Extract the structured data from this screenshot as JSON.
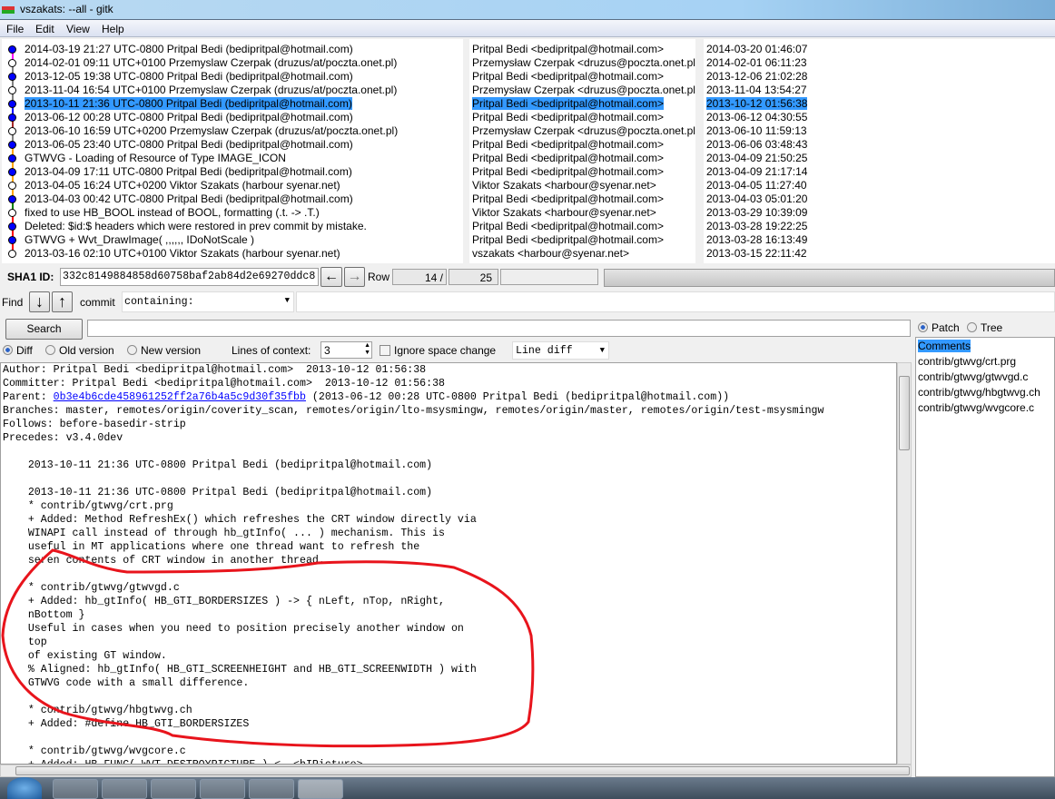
{
  "window": {
    "title": "vszakats: --all - gitk"
  },
  "menu": [
    "File",
    "Edit",
    "View",
    "Help"
  ],
  "commits": [
    {
      "subject": "2014-03-19 21:27 UTC-0800 Pritpal Bedi (bedipritpal@hotmail.com)",
      "author": "Pritpal Bedi <bedipritpal@hotmail.com>",
      "date": "2014-03-20 01:46:07",
      "filled": true
    },
    {
      "subject": "2014-02-01 09:11 UTC+0100 Przemyslaw Czerpak (druzus/at/poczta.onet.pl)",
      "author": "Przemysław Czerpak <druzus@poczta.onet.pl>",
      "date": "2014-02-01 06:11:23",
      "filled": false
    },
    {
      "subject": "2013-12-05 19:38 UTC-0800 Pritpal Bedi (bedipritpal@hotmail.com)",
      "author": "Pritpal Bedi <bedipritpal@hotmail.com>",
      "date": "2013-12-06 21:02:28",
      "filled": true
    },
    {
      "subject": "2013-11-04 16:54 UTC+0100 Przemyslaw Czerpak (druzus/at/poczta.onet.pl)",
      "author": "Przemysław Czerpak <druzus@poczta.onet.pl>",
      "date": "2013-11-04 13:54:27",
      "filled": false
    },
    {
      "subject": "2013-10-11 21:36 UTC-0800 Pritpal Bedi (bedipritpal@hotmail.com)",
      "author": "Pritpal Bedi <bedipritpal@hotmail.com>",
      "date": "2013-10-12 01:56:38",
      "filled": true,
      "selected": true
    },
    {
      "subject": "2013-06-12 00:28 UTC-0800 Pritpal Bedi (bedipritpal@hotmail.com)",
      "author": "Pritpal Bedi <bedipritpal@hotmail.com>",
      "date": "2013-06-12 04:30:55",
      "filled": true
    },
    {
      "subject": "2013-06-10 16:59 UTC+0200 Przemyslaw Czerpak (druzus/at/poczta.onet.pl)",
      "author": "Przemysław Czerpak <druzus@poczta.onet.pl>",
      "date": "2013-06-10 11:59:13",
      "filled": false
    },
    {
      "subject": "2013-06-05 23:40 UTC-0800 Pritpal Bedi (bedipritpal@hotmail.com)",
      "author": "Pritpal Bedi <bedipritpal@hotmail.com>",
      "date": "2013-06-06 03:48:43",
      "filled": true
    },
    {
      "subject": "GTWVG - Loading of Resource of Type IMAGE_ICON",
      "author": "Pritpal Bedi <bedipritpal@hotmail.com>",
      "date": "2013-04-09 21:50:25",
      "filled": true
    },
    {
      "subject": "2013-04-09 17:11 UTC-0800 Pritpal Bedi (bedipritpal@hotmail.com)",
      "author": "Pritpal Bedi <bedipritpal@hotmail.com>",
      "date": "2013-04-09 21:17:14",
      "filled": true
    },
    {
      "subject": "2013-04-05 16:24 UTC+0200 Viktor Szakats (harbour syenar.net)",
      "author": "Viktor Szakats <harbour@syenar.net>",
      "date": "2013-04-05 11:27:40",
      "filled": false
    },
    {
      "subject": "2013-04-03 00:42 UTC-0800 Pritpal Bedi (bedipritpal@hotmail.com)",
      "author": "Pritpal Bedi <bedipritpal@hotmail.com>",
      "date": "2013-04-03 05:01:20",
      "filled": true
    },
    {
      "subject": "fixed to use HB_BOOL instead of BOOL, formatting (.t. -> .T.)",
      "author": "Viktor Szakats <harbour@syenar.net>",
      "date": "2013-03-29 10:39:09",
      "filled": false
    },
    {
      "subject": "Deleted: $id:$ headers which were restored in prev commit by mistake.",
      "author": "Pritpal Bedi <bedipritpal@hotmail.com>",
      "date": "2013-03-28 19:22:25",
      "filled": true
    },
    {
      "subject": "GTWVG + Wvt_DrawImage( ,,,,,, IDoNotScale )",
      "author": "Pritpal Bedi <bedipritpal@hotmail.com>",
      "date": "2013-03-28 16:13:49",
      "filled": true
    },
    {
      "subject": "2013-03-16 02:10 UTC+0100 Viktor Szakats (harbour syenar.net)",
      "author": "vszakats <harbour@syenar.net>",
      "date": "2013-03-15 22:11:42",
      "filled": false
    }
  ],
  "graph_colors": [
    "#ff00ff",
    "#808080",
    "#808080",
    "#808080",
    "#0000ff",
    "#a52a2a",
    "#808080",
    "#ffa500",
    "#ffa500",
    "#ffa500",
    "#ffa500",
    "#008000",
    "#ff0000",
    "#ff0000",
    "#ff0000"
  ],
  "sha": {
    "label": "SHA1 ID:",
    "value": "332c8149884858d60758baf2ab84d2e69270ddc8",
    "row_label": "Row",
    "row_current": "14 /",
    "row_total": "25"
  },
  "find": {
    "label": "Find",
    "type": "commit",
    "mode": "containing:"
  },
  "search": {
    "button": "Search"
  },
  "diffopts": {
    "diff": "Diff",
    "old": "Old version",
    "new": "New version",
    "context_label": "Lines of context:",
    "context_value": "3",
    "ignore_space": "Ignore space change",
    "diff_mode": "Line diff"
  },
  "diff": {
    "header": [
      "Author: Pritpal Bedi <bedipritpal@hotmail.com>  2013-10-12 01:56:38",
      "Committer: Pritpal Bedi <bedipritpal@hotmail.com>  2013-10-12 01:56:38"
    ],
    "parent_label": "Parent: ",
    "parent_sha": "0b3e4b6cde458961252ff2a76b4a5c9d30f35fbb",
    "parent_rest": " (2013-06-12 00:28 UTC-0800 Pritpal Bedi (bedipritpal@hotmail.com))",
    "header2": [
      "Branches: master, remotes/origin/coverity_scan, remotes/origin/lto-msysmingw, remotes/origin/master, remotes/origin/test-msysmingw",
      "Follows: before-basedir-strip",
      "Precedes: v3.4.0dev"
    ],
    "body": [
      "",
      "    2013-10-11 21:36 UTC-0800 Pritpal Bedi (bedipritpal@hotmail.com)",
      "",
      "    2013-10-11 21:36 UTC-0800 Pritpal Bedi (bedipritpal@hotmail.com)",
      "    * contrib/gtwvg/crt.prg",
      "    + Added: Method RefreshEx() which refreshes the CRT window directly via",
      "    WINAPI call instead of through hb_gtInfo( ... ) mechanism. This is",
      "    useful in MT applications where one thread want to refresh the",
      "    seren contents of CRT window in another thread.",
      "",
      "    * contrib/gtwvg/gtwvgd.c",
      "    + Added: hb_gtInfo( HB_GTI_BORDERSIZES ) -> { nLeft, nTop, nRight,",
      "    nBottom }",
      "    Useful in cases when you need to position precisely another window on",
      "    top",
      "    of existing GT window.",
      "    % Aligned: hb_gtInfo( HB_GTI_SCREENHEIGHT and HB_GTI_SCREENWIDTH ) with",
      "    GTWVG code with a small difference.",
      "",
      "    * contrib/gtwvg/hbgtwvg.ch",
      "    + Added: #define HB_GTI_BORDERSIZES",
      "",
      "    * contrib/gtwvg/wvgcore.c",
      "    + Added: HB_FUNC( WVT_DESTROYPICTURE ) <- <hIPicture>"
    ]
  },
  "filepane": {
    "patch": "Patch",
    "tree": "Tree",
    "files": [
      "Comments",
      "contrib/gtwvg/crt.prg",
      "contrib/gtwvg/gtwvgd.c",
      "contrib/gtwvg/hbgtwvg.ch",
      "contrib/gtwvg/wvgcore.c"
    ]
  },
  "annotation_color": "#e8141c"
}
